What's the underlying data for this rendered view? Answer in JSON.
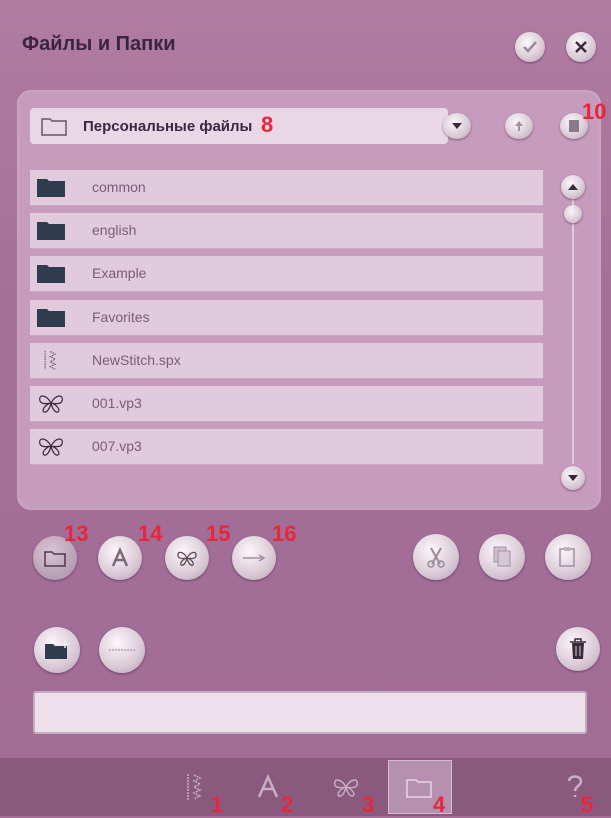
{
  "window": {
    "title": "Файлы и Папки",
    "ok_icon": "checkmark-icon",
    "close_icon": "close-icon"
  },
  "pathbar": {
    "current_folder": "Персональные файлы",
    "dropdown_icon": "chevron-down-icon",
    "up_icon": "folder-up-icon",
    "view_icon": "view-mode-icon"
  },
  "files": [
    {
      "name": "common",
      "type": "folder"
    },
    {
      "name": "english",
      "type": "folder"
    },
    {
      "name": "Example",
      "type": "folder"
    },
    {
      "name": "Favorites",
      "type": "folder"
    },
    {
      "name": "NewStitch.spx",
      "type": "stitch"
    },
    {
      "name": "001.vp3",
      "type": "embroidery"
    },
    {
      "name": "007.vp3",
      "type": "embroidery"
    }
  ],
  "filters": {
    "folder": "folder-filter-icon",
    "font": "font-filter-icon",
    "embroidery": "embroidery-filter-icon",
    "usb": "usb-icon"
  },
  "actions": {
    "cut": "scissors-icon",
    "copy": "copy-icon",
    "paste": "paste-icon",
    "new_folder": "new-folder-icon",
    "rename": "rename-icon",
    "delete": "trash-icon"
  },
  "status_text": "",
  "callouts": [
    "1",
    "2",
    "3",
    "4",
    "5",
    "8",
    "10",
    "13",
    "14",
    "15",
    "16"
  ],
  "tabs": [
    {
      "name": "stitch-menu-tab",
      "callout": "1"
    },
    {
      "name": "font-menu-tab",
      "callout": "2"
    },
    {
      "name": "embroidery-menu-tab",
      "callout": "3"
    },
    {
      "name": "files-folders-tab",
      "callout": "4",
      "active": true
    },
    {
      "name": "help-tab",
      "callout": "5"
    }
  ],
  "colors": {
    "window_bg": "#a76f97",
    "panel_bg": "#c69bbd",
    "row_bg": "#e1cadc",
    "row_text": "#7b5c7a",
    "bottombar_bg": "#8a5a7e",
    "callout_red": "#e8263b"
  }
}
